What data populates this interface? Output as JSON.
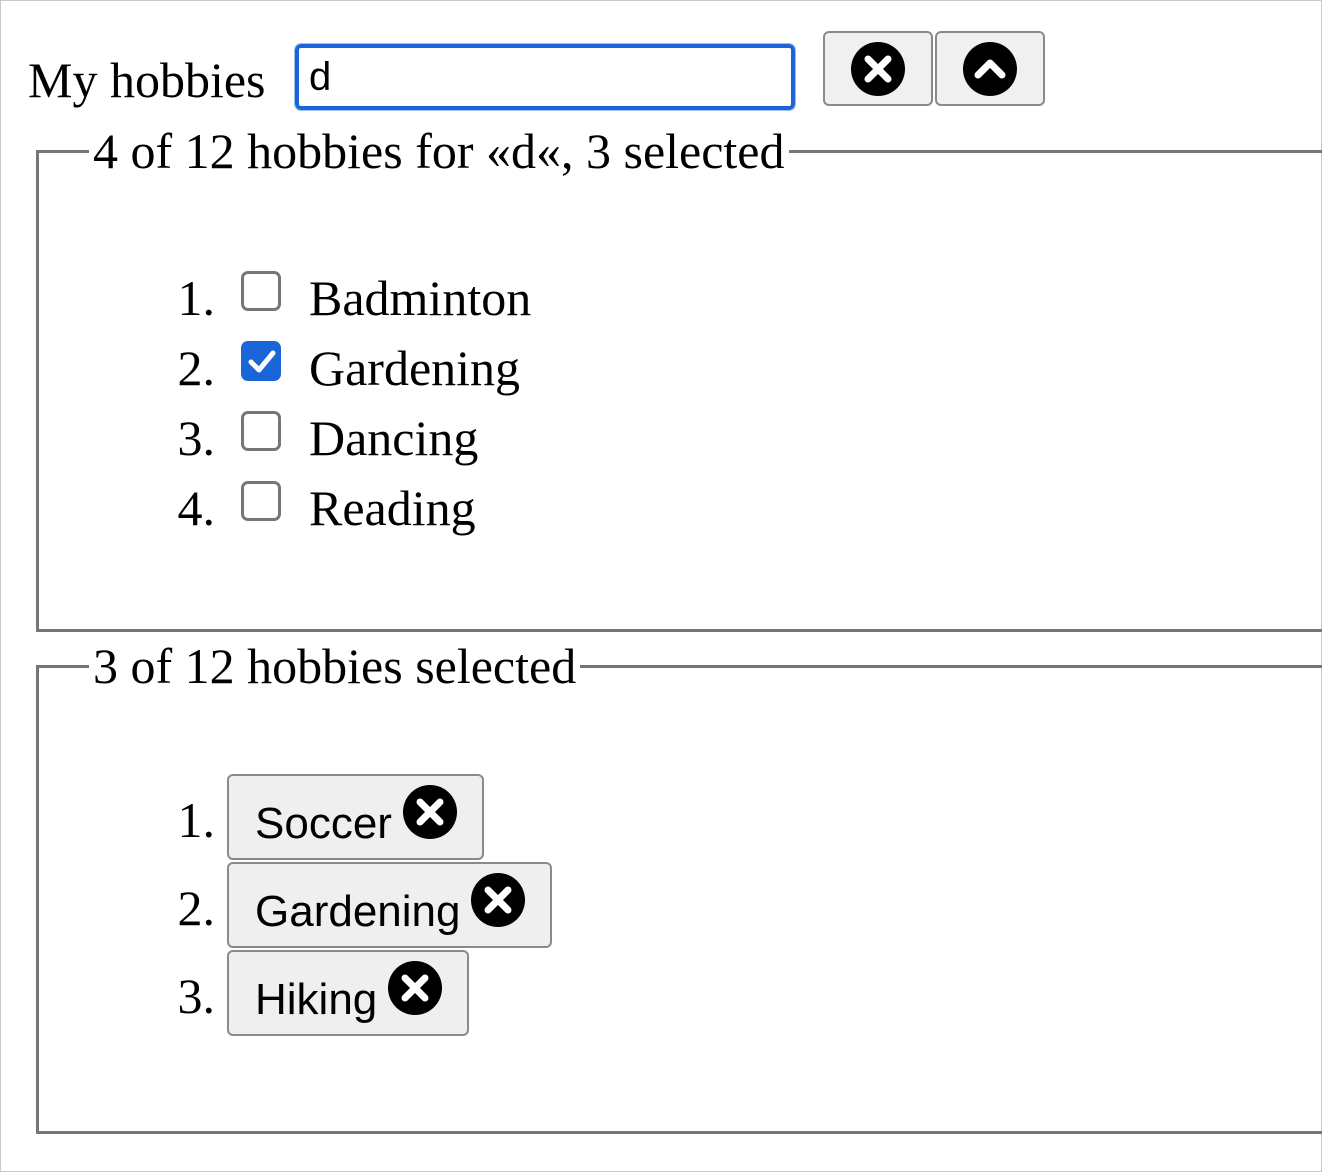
{
  "search": {
    "label": "My hobbies",
    "value": "d",
    "clear_button_icon": "close-circle-icon",
    "toggle_button_icon": "chevron-up-circle-icon"
  },
  "results": {
    "legend": "4 of 12 hobbies for «d«, 3 selected",
    "items": [
      {
        "number": "1.",
        "label": "Badminton",
        "checked": false
      },
      {
        "number": "2.",
        "label": "Gardening",
        "checked": true
      },
      {
        "number": "3.",
        "label": "Dancing",
        "checked": false
      },
      {
        "number": "4.",
        "label": "Reading",
        "checked": false
      }
    ]
  },
  "selected": {
    "legend": "3 of 12 hobbies selected",
    "items": [
      {
        "number": "1.",
        "label": "Soccer",
        "icon": "close-circle-icon"
      },
      {
        "number": "2.",
        "label": "Gardening",
        "icon": "close-circle-icon"
      },
      {
        "number": "3.",
        "label": "Hiking",
        "icon": "close-circle-icon"
      }
    ]
  },
  "colors": {
    "focus_ring": "#1a66d9",
    "checkbox_checked": "#1a66d9",
    "border": "#767676",
    "button_bg": "#f0f0f0"
  }
}
